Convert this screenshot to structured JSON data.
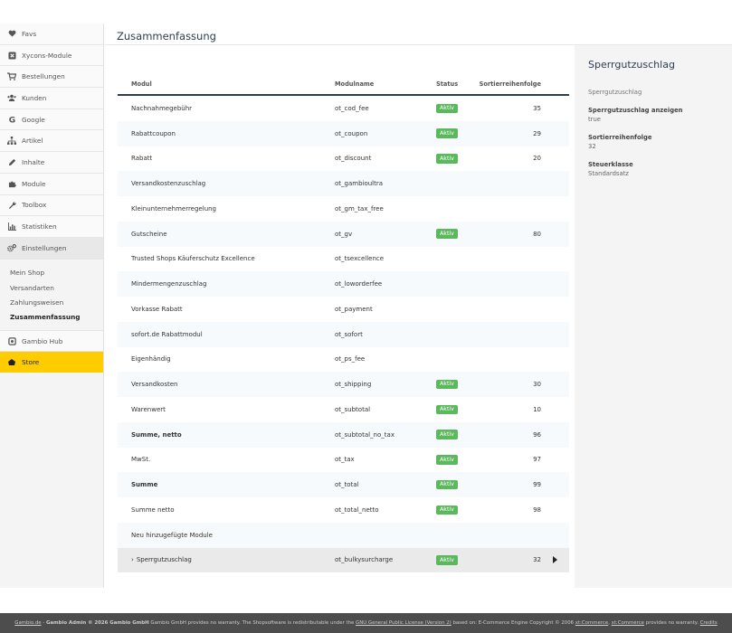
{
  "sidebar": {
    "items": [
      {
        "label": "Favs",
        "icon": "heart-icon"
      },
      {
        "label": "Xycons-Module",
        "icon": "xycons-icon"
      },
      {
        "label": "Bestellungen",
        "icon": "cart-icon"
      },
      {
        "label": "Kunden",
        "icon": "users-icon"
      },
      {
        "label": "Google",
        "icon": "google-icon"
      },
      {
        "label": "Artikel",
        "icon": "sitemap-icon"
      },
      {
        "label": "Inhalte",
        "icon": "pencil-icon"
      },
      {
        "label": "Module",
        "icon": "puzzle-icon"
      },
      {
        "label": "Toolbox",
        "icon": "wrench-icon"
      },
      {
        "label": "Statistiken",
        "icon": "bar-chart-icon"
      },
      {
        "label": "Einstellungen",
        "icon": "gears-icon"
      }
    ],
    "submenu": [
      "Mein Shop",
      "Versandarten",
      "Zahlungsweisen",
      "Zusammenfassung"
    ],
    "hub": {
      "label": "Gambio Hub",
      "icon": "hub-icon"
    },
    "store": {
      "label": "Store",
      "icon": "store-icon"
    }
  },
  "page": {
    "title": "Zusammenfassung"
  },
  "table": {
    "headers": {
      "module": "Modul",
      "name": "Modulname",
      "status": "Status",
      "sort": "Sortierreihenfolge"
    },
    "rows": [
      {
        "module": "Nachnahmegebühr",
        "name": "ot_cod_fee",
        "status": "Aktiv",
        "sort": "35"
      },
      {
        "module": "Rabattcoupon",
        "name": "ot_coupon",
        "status": "Aktiv",
        "sort": "29"
      },
      {
        "module": "Rabatt",
        "name": "ot_discount",
        "status": "Aktiv",
        "sort": "20"
      },
      {
        "module": "Versandkostenzuschlag",
        "name": "ot_gambioultra",
        "status": "",
        "sort": ""
      },
      {
        "module": "Kleinunternehmerregelung",
        "name": "ot_gm_tax_free",
        "status": "",
        "sort": ""
      },
      {
        "module": "Gutscheine",
        "name": "ot_gv",
        "status": "Aktiv",
        "sort": "80"
      },
      {
        "module": "Trusted Shops Käuferschutz Excellence",
        "name": "ot_tsexcellence",
        "status": "",
        "sort": ""
      },
      {
        "module": "Mindermengenzuschlag",
        "name": "ot_loworderfee",
        "status": "",
        "sort": ""
      },
      {
        "module": "Vorkasse Rabatt",
        "name": "ot_payment",
        "status": "",
        "sort": ""
      },
      {
        "module": "sofort.de Rabattmodul",
        "name": "ot_sofort",
        "status": "",
        "sort": ""
      },
      {
        "module": "Eigenhändig",
        "name": "ot_ps_fee",
        "status": "",
        "sort": ""
      },
      {
        "module": "Versandkosten",
        "name": "ot_shipping",
        "status": "Aktiv",
        "sort": "30"
      },
      {
        "module": "Warenwert",
        "name": "ot_subtotal",
        "status": "Aktiv",
        "sort": "10"
      },
      {
        "module": "Summe, netto",
        "name": "ot_subtotal_no_tax",
        "status": "Aktiv",
        "sort": "96",
        "bold": true
      },
      {
        "module": "MwSt.",
        "name": "ot_tax",
        "status": "Aktiv",
        "sort": "97"
      },
      {
        "module": "Summe",
        "name": "ot_total",
        "status": "Aktiv",
        "sort": "99",
        "bold": true
      },
      {
        "module": "Summe netto",
        "name": "ot_total_netto",
        "status": "Aktiv",
        "sort": "98"
      },
      {
        "module": "Neu hinzugefügte Module",
        "name": "",
        "status": "",
        "sort": ""
      },
      {
        "module": "Sperrgutzuschlag",
        "name": "ot_bulkysurcharge",
        "status": "Aktiv",
        "sort": "32",
        "selected": true
      }
    ]
  },
  "panel": {
    "title": "Sperrgutzuschlag",
    "subtitle": "Sperrgutzuschlag",
    "fields": [
      {
        "label": "Sperrgutzuschlag anzeigen",
        "value": "true"
      },
      {
        "label": "Sortierreihenfolge",
        "value": "32"
      },
      {
        "label": "Steuerklasse",
        "value": "Standardsatz"
      }
    ]
  },
  "footer": {
    "brand": "Gambio.de",
    "admin": "Gambio Admin © 2026 Gambio GmbH",
    "text1": "Gambio GmbH provides no warranty. The Shopsoftware is redistributable under the",
    "license": "GNU General Public License (Version 2)",
    "text2": "based on: E-Commerce Engine Copyright © 2006",
    "xtc": "xt:Commerce",
    "text3": ",",
    "xtc2": "xt:Commerce",
    "text4": "provides no warranty.",
    "credits": "Credits"
  },
  "colors": {
    "accent": "#ffcc00",
    "status_active": "#5cb85c",
    "header_rule": "#2c3e50",
    "footer_bg": "#4d4d4d"
  }
}
